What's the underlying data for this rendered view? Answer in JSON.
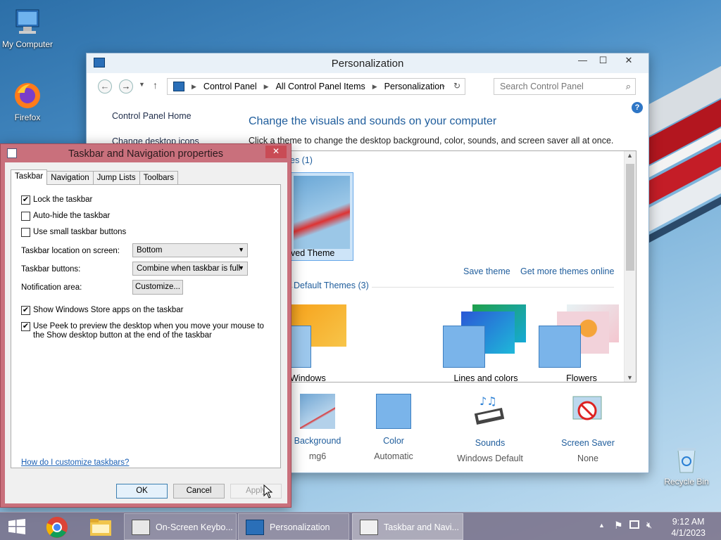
{
  "desktop": {
    "icons": [
      {
        "label": "My Computer"
      },
      {
        "label": "Firefox"
      },
      {
        "label": "Recycle Bin"
      }
    ]
  },
  "personalization": {
    "title": "Personalization",
    "breadcrumb": [
      "Control Panel",
      "All Control Panel Items",
      "Personalization"
    ],
    "search_placeholder": "Search Control Panel",
    "left_links": [
      "Control Panel Home",
      "Change desktop icons"
    ],
    "heading": "Change the visuals and sounds on your computer",
    "subheading": "Click a theme to change the desktop background, color, sounds, and screen saver all at once.",
    "my_themes_label": "es (1)",
    "unsaved_theme_label": "ved Theme",
    "save_theme": "Save theme",
    "get_more_themes": "Get more themes online",
    "default_themes_label": "Default Themes (3)",
    "default_themes": [
      {
        "label": "Windows"
      },
      {
        "label": "Lines and colors"
      },
      {
        "label": "Flowers"
      }
    ],
    "bottom": [
      {
        "label": "Background",
        "value": "mg6"
      },
      {
        "label": "Color",
        "value": "Automatic"
      },
      {
        "label": "Sounds",
        "value": "Windows Default"
      },
      {
        "label": "Screen Saver",
        "value": "None"
      }
    ]
  },
  "dialog": {
    "title": "Taskbar and Navigation properties",
    "tabs": [
      "Taskbar",
      "Navigation",
      "Jump Lists",
      "Toolbars"
    ],
    "checkboxes": [
      {
        "label": "Lock the taskbar",
        "checked": true
      },
      {
        "label": "Auto-hide the taskbar",
        "checked": false
      },
      {
        "label": "Use small taskbar buttons",
        "checked": false
      },
      {
        "label": "Show Windows Store apps on the taskbar",
        "checked": true
      },
      {
        "label": "Use Peek to preview the desktop when you move your mouse to the Show desktop button at the end of the taskbar",
        "checked": true
      }
    ],
    "location_label": "Taskbar location on screen:",
    "location_value": "Bottom",
    "buttons_label": "Taskbar buttons:",
    "buttons_value": "Combine when taskbar is full",
    "notification_label": "Notification area:",
    "customize": "Customize...",
    "help_link": "How do I customize taskbars?",
    "ok": "OK",
    "cancel": "Cancel",
    "apply": "Apply"
  },
  "taskbar": {
    "items": [
      {
        "label": "On-Screen Keybo..."
      },
      {
        "label": "Personalization"
      },
      {
        "label": "Taskbar and Navi..."
      }
    ],
    "time": "9:12 AM",
    "date": "4/1/2023"
  }
}
